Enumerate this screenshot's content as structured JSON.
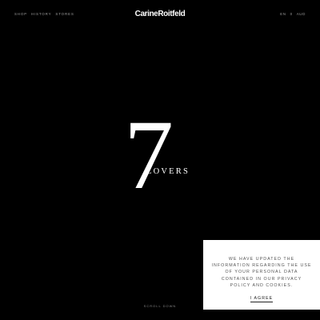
{
  "header": {
    "nav_items": [
      "SHOP",
      "HISTORY",
      "STORES"
    ],
    "brand": "CarineRoitfeld",
    "language": "EN",
    "cart_count": "0",
    "currency": "AUD"
  },
  "hero": {
    "number": "7",
    "word": "LOVERS",
    "scroll_hint": "SCROLL DOWN"
  },
  "cookie_notice": {
    "message": "WE HAVE UPDATED THE INFORMATION REGARDING THE USE OF YOUR PERSONAL DATA CONTAINED IN OUR PRIVACY POLICY AND COOKIES.",
    "agree_label": "I AGREE"
  },
  "colors": {
    "background": "#000000",
    "foreground": "#ffffff",
    "nav_text": "#9a9a9a",
    "cookie_background": "#ffffff",
    "cookie_text": "#555555"
  }
}
